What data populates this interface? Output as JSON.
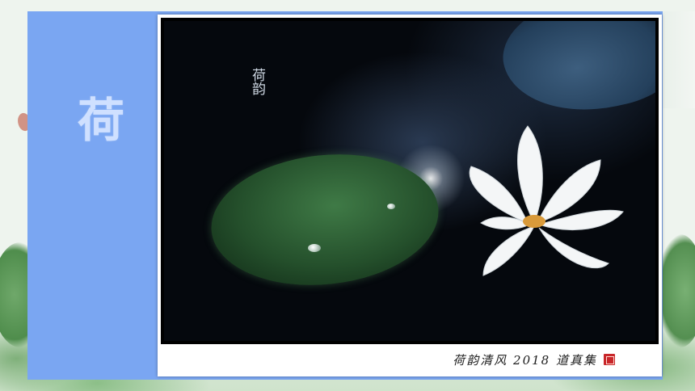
{
  "slide": {
    "title": "荷",
    "poem": "荷韵",
    "caption": "荷韵清风 2018 道真集",
    "colors": {
      "panel": "#7aa6f2",
      "title": "#cfe0ff",
      "card": "#ffffff",
      "seal": "#c8262a"
    },
    "icons": {
      "seal": "seal-stamp-icon"
    }
  }
}
